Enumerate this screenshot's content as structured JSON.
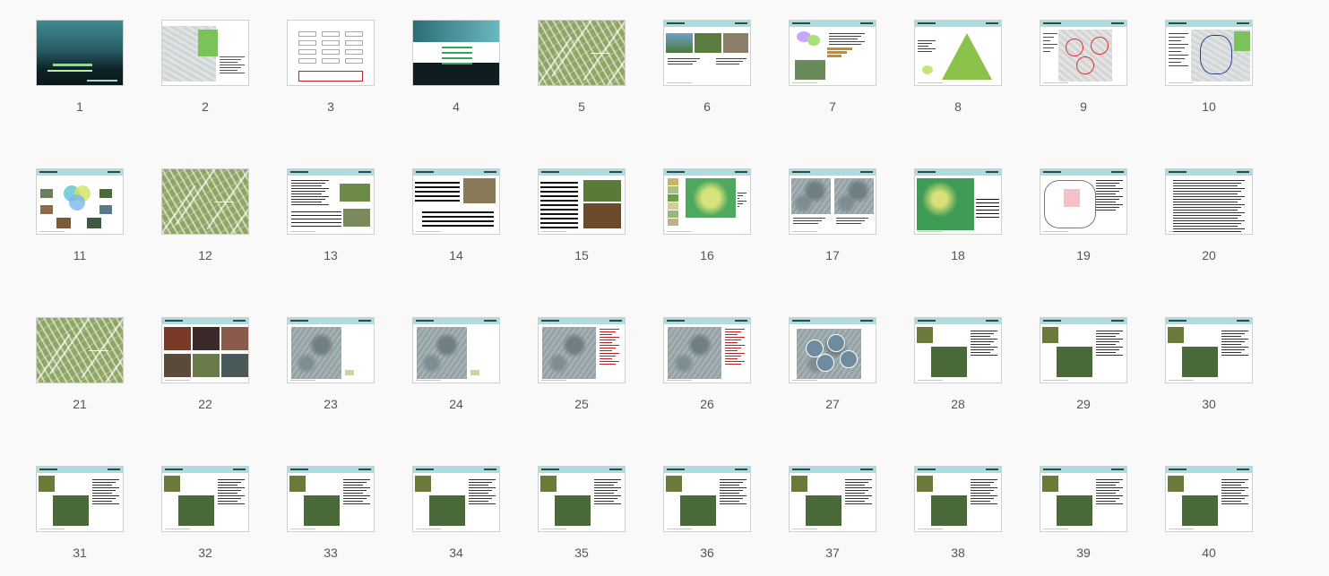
{
  "slides": [
    {
      "n": "1",
      "v": "cover"
    },
    {
      "n": "2",
      "v": "map"
    },
    {
      "n": "3",
      "v": "flow"
    },
    {
      "n": "4",
      "v": "section"
    },
    {
      "n": "5",
      "v": "fern"
    },
    {
      "n": "6",
      "v": "photo-row"
    },
    {
      "n": "7",
      "v": "chart"
    },
    {
      "n": "8",
      "v": "pyramid"
    },
    {
      "n": "9",
      "v": "circles-map"
    },
    {
      "n": "10",
      "v": "route-map"
    },
    {
      "n": "11",
      "v": "venn"
    },
    {
      "n": "12",
      "v": "fern"
    },
    {
      "n": "13",
      "v": "text-table"
    },
    {
      "n": "14",
      "v": "table-photo"
    },
    {
      "n": "15",
      "v": "table-photos"
    },
    {
      "n": "16",
      "v": "green-map-legend"
    },
    {
      "n": "17",
      "v": "two-terrain"
    },
    {
      "n": "18",
      "v": "green-map"
    },
    {
      "n": "19",
      "v": "outline-map"
    },
    {
      "n": "20",
      "v": "text-only"
    },
    {
      "n": "21",
      "v": "fern"
    },
    {
      "n": "22",
      "v": "photo-grid"
    },
    {
      "n": "23",
      "v": "terrain"
    },
    {
      "n": "24",
      "v": "terrain"
    },
    {
      "n": "25",
      "v": "terrain-legend"
    },
    {
      "n": "26",
      "v": "terrain-legend"
    },
    {
      "n": "27",
      "v": "circles-terrain"
    },
    {
      "n": "28",
      "v": "map-photos"
    },
    {
      "n": "29",
      "v": "photo-text"
    },
    {
      "n": "30",
      "v": "photo-text"
    },
    {
      "n": "31",
      "v": "photo-text"
    },
    {
      "n": "32",
      "v": "photo-text"
    },
    {
      "n": "33",
      "v": "photo-text"
    },
    {
      "n": "34",
      "v": "photo-text"
    },
    {
      "n": "35",
      "v": "photo-text"
    },
    {
      "n": "36",
      "v": "photo-text"
    },
    {
      "n": "37",
      "v": "photo-text"
    },
    {
      "n": "38",
      "v": "photo-text"
    },
    {
      "n": "39",
      "v": "photo-text"
    },
    {
      "n": "40",
      "v": "photo-text"
    }
  ],
  "colors": {
    "background": "#f9f9f9",
    "header_band": "#a9dde0",
    "label": "#555555",
    "accent_green": "#8bc34a",
    "accent_red": "#c02020"
  }
}
